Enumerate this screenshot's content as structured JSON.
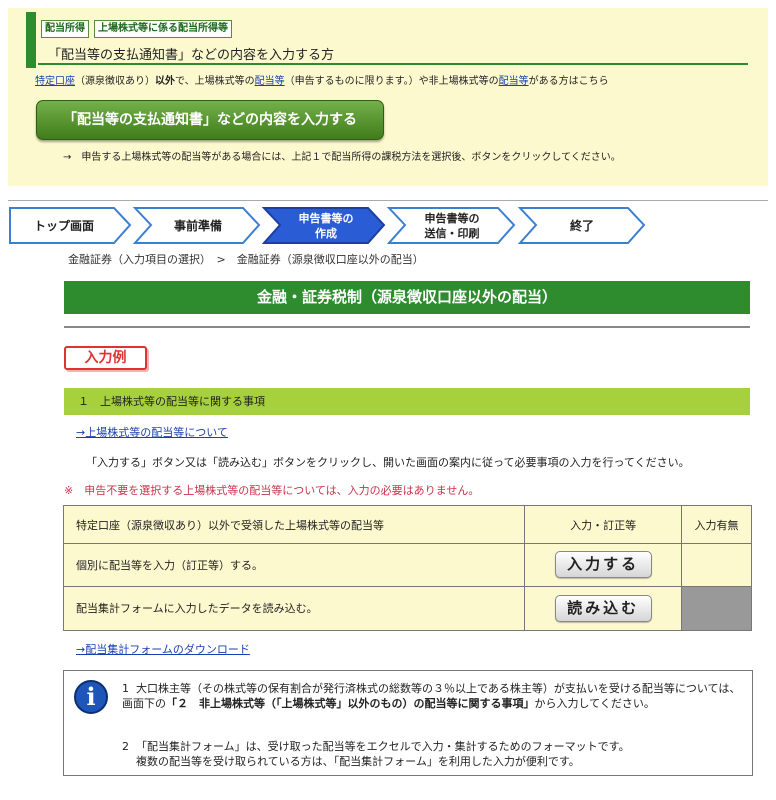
{
  "top_panel": {
    "tags": [
      "配当所得",
      "上場株式等に係る配当所得等"
    ],
    "heading": "「配当等の支払通知書」などの内容を入力する方",
    "note_link1": "特定口座",
    "note_part1": "（源泉徴収あり）",
    "note_bold": "以外",
    "note_part2": "で、上場株式等の",
    "note_link2": "配当等",
    "note_part3": "（申告するものに限ります。）や非上場株式等の",
    "note_link3": "配当等",
    "note_part4": "がある方はこちら",
    "big_button": "「配当等の支払通知書」などの内容を入力する",
    "instruction": "→　申告する上場株式等の配当等がある場合には、上記１で配当所得の課税方法を選択後、ボタンをクリックしてください。"
  },
  "steps": [
    {
      "line1": "トップ画面",
      "line2": "",
      "active": false
    },
    {
      "line1": "事前準備",
      "line2": "",
      "active": false
    },
    {
      "line1": "申告書等の",
      "line2": "作成",
      "active": true
    },
    {
      "line1": "申告書等の",
      "line2": "送信・印刷",
      "active": false
    },
    {
      "line1": "終了",
      "line2": "",
      "active": false
    }
  ],
  "breadcrumb": "金融証券（入力項目の選択）　>　金融証券（源泉徴収口座以外の配当）",
  "page_title": "金融・証券税制（源泉徴収口座以外の配当）",
  "example_badge": "入力例",
  "section_heading": "１　上場株式等の配当等に関する事項",
  "about_link": "→上場株式等の配当等について",
  "instruction": "「入力する」ボタン又は「読み込む」ボタンをクリックし、開いた画面の案内に従って必要事項の入力を行ってください。",
  "warning": "※　申告不要を選択する上場株式等の配当等については、入力の必要はありません。",
  "table": {
    "headers": [
      "特定口座（源泉徴収あり）以外で受領した上場株式等の配当等",
      "入力・訂正等",
      "入力有無"
    ],
    "rows": [
      {
        "label": "個別に配当等を入力（訂正等）する。",
        "button": "入力する"
      },
      {
        "label": "配当集計フォームに入力したデータを読み込む。",
        "button": "読み込む"
      }
    ]
  },
  "download_link": "→配当集計フォームのダウンロード",
  "info": {
    "icon_name": "info-icon",
    "icon_glyph": "i",
    "item1_num": "1",
    "item1_text_a": "大口株主等（その株式等の保有割合が発行済株式の総数等の３％以上である株主等）が支払いを受ける配当等については、画面下の",
    "item1_bold": "「２　非上場株式等（「上場株式等」以外のもの）の配当等に関する事項」",
    "item1_text_b": "から入力してください。",
    "item2_num": "2",
    "item2_line1": "「配当集計フォーム」は、受け取った配当等をエクセルで入力・集計するためのフォーマットです。",
    "item2_line2": "複数の配当等を受け取られている方は、「配当集計フォーム」を利用した入力が便利です。"
  },
  "colors": {
    "panel_bg": "#fdf9cf",
    "green": "#2e8b2e",
    "section_bar": "#a7d13c",
    "active_step": "#2a5cd6",
    "warning": "#c8344a",
    "link": "#1a3fb0"
  }
}
